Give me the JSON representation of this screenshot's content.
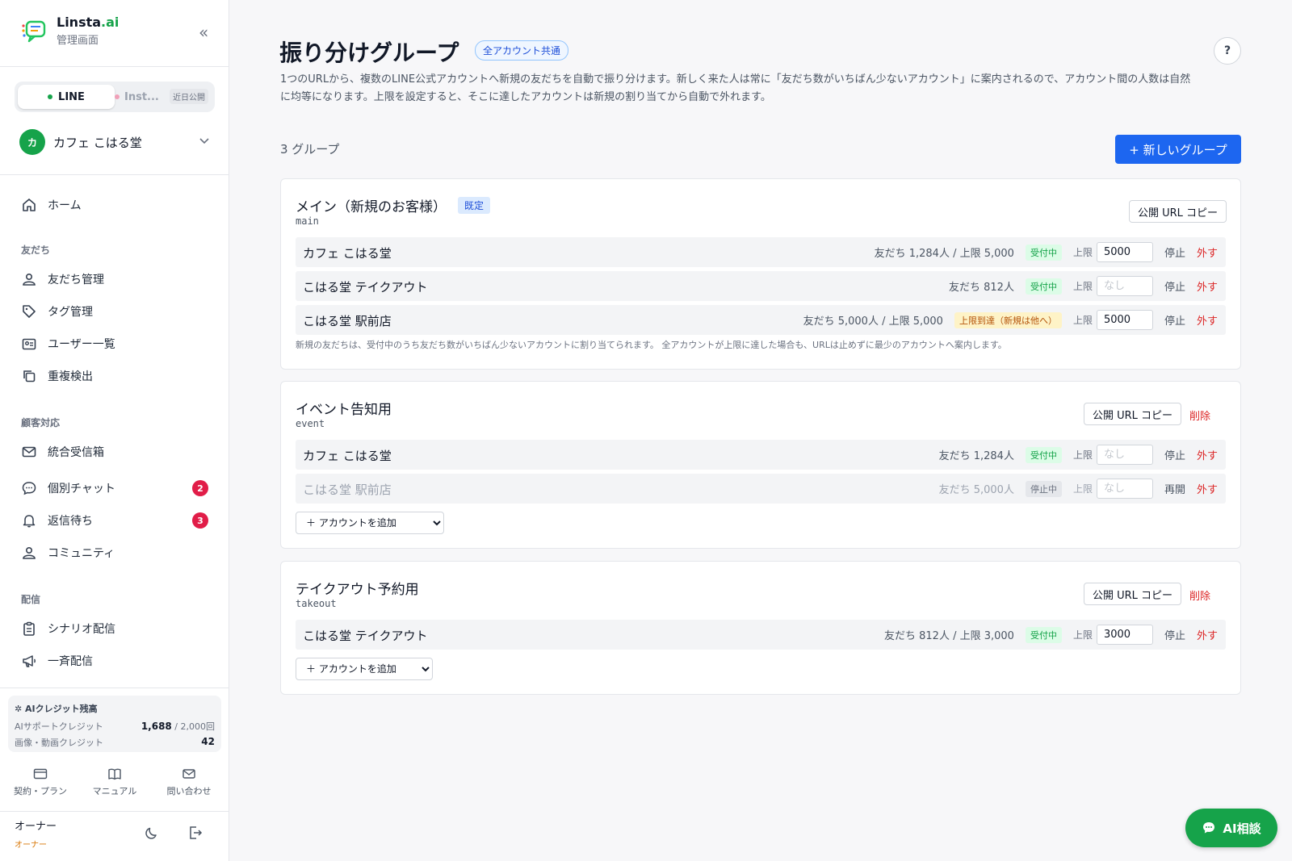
{
  "brand": {
    "name": "Linsta",
    "name_suffix": ".ai",
    "subtitle": "管理画面"
  },
  "channel_switch": {
    "line_label": "LINE",
    "instagram_label": "Inst...",
    "instagram_badge": "近日公開"
  },
  "account": {
    "avatar_initial": "カ",
    "name": "カフェ こはる堂"
  },
  "nav": {
    "home": "ホーム",
    "section_friends": "友だち",
    "friends_manage": "友だち管理",
    "tag_manage": "タグ管理",
    "user_list": "ユーザー一覧",
    "duplicate_detect": "重複検出",
    "section_support": "顧客対応",
    "unified_inbox": "統合受信箱",
    "individual_chat": "個別チャット",
    "individual_chat_badge": "2",
    "awaiting_reply": "返信待ち",
    "awaiting_reply_badge": "3",
    "community": "コミュニティ",
    "section_delivery": "配信",
    "scenario_delivery": "シナリオ配信",
    "bulk_delivery": "一斉配信"
  },
  "credits": {
    "title": "AIクレジット残高",
    "support_label": "AIサポートクレジット",
    "support_value": "1,688",
    "support_max": "/ 2,000回",
    "media_label": "画像・動画クレジット",
    "media_value": "42"
  },
  "footer_links": {
    "plan": "契約・プラン",
    "manual": "マニュアル",
    "contact": "問い合わせ"
  },
  "owner": {
    "name": "オーナー",
    "role": "オーナー"
  },
  "page": {
    "title": "振り分けグループ",
    "scope_badge": "全アカウント共通",
    "help": "?",
    "description": "1つのURLから、複数のLINE公式アカウントへ新規の友だちを自動で振り分けます。新しく来た人は常に「友だち数がいちばん少ないアカウント」に案内されるので、アカウント間の人数は自然に均等になります。上限を設定すると、そこに達したアカウントは新規の割り当てから自動で外れます。",
    "group_count": "3 グループ",
    "new_group_button": "+ 新しいグループ"
  },
  "common": {
    "copy_url": "公開 URL コピー",
    "delete": "削除",
    "limit_label": "上限",
    "limit_placeholder": "なし",
    "stop": "停止",
    "resume": "再開",
    "remove": "外す",
    "add_account": "＋ アカウントを追加"
  },
  "groups": [
    {
      "title": "メイン（新規のお客様）",
      "default_badge": "既定",
      "slug": "main",
      "rows": [
        {
          "name": "カフェ こはる堂",
          "stats": "友だち 1,284人 / 上限 5,000",
          "status": "受付中",
          "limit": "5000"
        },
        {
          "name": "こはる堂 テイクアウト",
          "stats": "友だち 812人",
          "status": "受付中",
          "limit": ""
        },
        {
          "name": "こはる堂 駅前店",
          "stats": "友だち 5,000人 / 上限 5,000",
          "status": "上限到達（新規は他へ）",
          "limit": "5000"
        }
      ],
      "note": "新規の友だちは、受付中のうち友だち数がいちばん少ないアカウントに割り当てられます。 全アカウントが上限に達した場合も、URLは止めずに最少のアカウントへ案内します。"
    },
    {
      "title": "イベント告知用",
      "slug": "event",
      "rows": [
        {
          "name": "カフェ こはる堂",
          "stats": "友だち 1,284人",
          "status": "受付中",
          "limit": ""
        },
        {
          "name": "こはる堂 駅前店",
          "stats": "友だち 5,000人",
          "status": "停止中",
          "limit": ""
        }
      ]
    },
    {
      "title": "テイクアウト予約用",
      "slug": "takeout",
      "rows": [
        {
          "name": "こはる堂 テイクアウト",
          "stats": "友だち 812人 / 上限 3,000",
          "status": "受付中",
          "limit": "3000"
        }
      ]
    }
  ],
  "ai_chat_button": "AI相談",
  "colors": {
    "accent_blue": "#1d66f0",
    "brand_green": "#16a34a",
    "danger_red": "#dc2626",
    "badge_red": "#e11d48"
  }
}
